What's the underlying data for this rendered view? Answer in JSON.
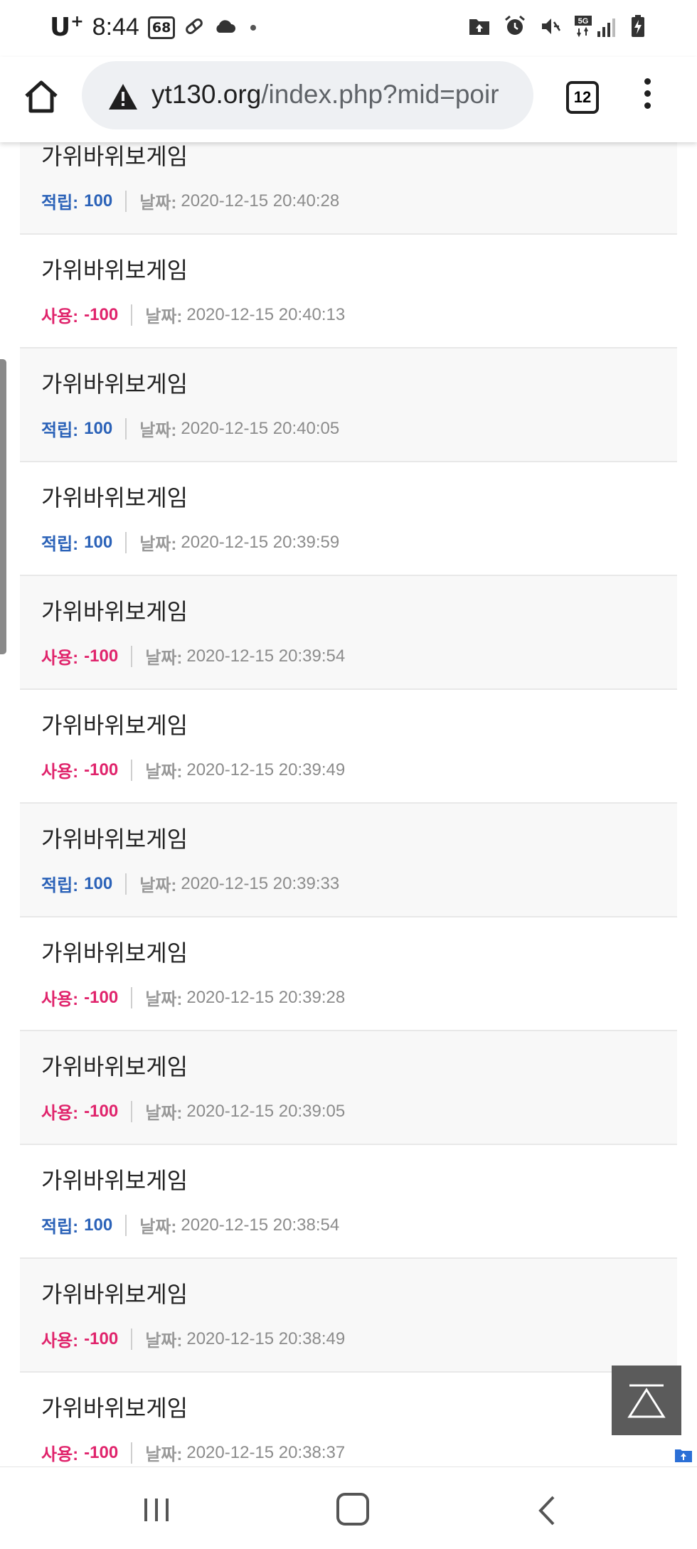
{
  "status_bar": {
    "carrier": "U",
    "carrier_sup": "+",
    "time": "8:44",
    "badge": "68"
  },
  "browser": {
    "url_host": "yt130.org",
    "url_path": "/index.php?mid=poir",
    "tab_count": "12"
  },
  "labels": {
    "earn": "적립:",
    "use": "사용:",
    "date": "날짜:"
  },
  "entries": [
    {
      "title": "가위바위보게임",
      "type": "earn",
      "amount": "100",
      "date": "2020-12-15 20:40:28"
    },
    {
      "title": "가위바위보게임",
      "type": "use",
      "amount": "-100",
      "date": "2020-12-15 20:40:13"
    },
    {
      "title": "가위바위보게임",
      "type": "earn",
      "amount": "100",
      "date": "2020-12-15 20:40:05"
    },
    {
      "title": "가위바위보게임",
      "type": "earn",
      "amount": "100",
      "date": "2020-12-15 20:39:59"
    },
    {
      "title": "가위바위보게임",
      "type": "use",
      "amount": "-100",
      "date": "2020-12-15 20:39:54"
    },
    {
      "title": "가위바위보게임",
      "type": "use",
      "amount": "-100",
      "date": "2020-12-15 20:39:49"
    },
    {
      "title": "가위바위보게임",
      "type": "earn",
      "amount": "100",
      "date": "2020-12-15 20:39:33"
    },
    {
      "title": "가위바위보게임",
      "type": "use",
      "amount": "-100",
      "date": "2020-12-15 20:39:28"
    },
    {
      "title": "가위바위보게임",
      "type": "use",
      "amount": "-100",
      "date": "2020-12-15 20:39:05"
    },
    {
      "title": "가위바위보게임",
      "type": "earn",
      "amount": "100",
      "date": "2020-12-15 20:38:54"
    },
    {
      "title": "가위바위보게임",
      "type": "use",
      "amount": "-100",
      "date": "2020-12-15 20:38:49"
    },
    {
      "title": "가위바위보게임",
      "type": "use",
      "amount": "-100",
      "date": "2020-12-15 20:38:37"
    }
  ],
  "colors": {
    "earn": "#2b62b8",
    "use": "#e0246c",
    "row_shaded": "#f8f8f8"
  },
  "icons": {
    "home": "home-icon",
    "warning": "warning-icon",
    "menu": "more-vert-icon",
    "to_top": "scroll-to-top-icon"
  }
}
